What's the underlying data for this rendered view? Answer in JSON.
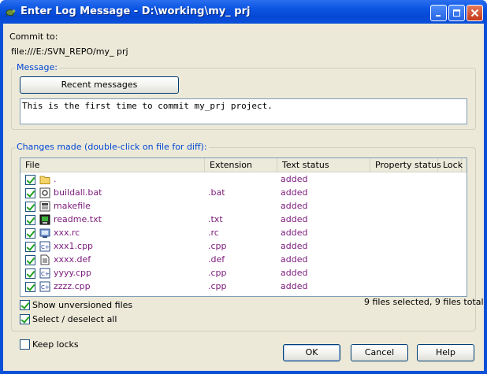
{
  "window": {
    "title": "Enter Log Message - D:\\working\\my_ prj"
  },
  "commit": {
    "label": "Commit to:",
    "url": "file:///E:/SVN_REPO/my_ prj"
  },
  "message_group": {
    "title": "Message:",
    "recent_button": "Recent messages",
    "text": "This is the first time to commit my_prj project."
  },
  "changes_group": {
    "title": "Changes made (double-click on file for diff):",
    "columns": [
      "File",
      "Extension",
      "Text status",
      "Property status",
      "Lock"
    ],
    "rows": [
      {
        "name": ".",
        "ext": "",
        "status": "added",
        "checked": true,
        "icon": "folder-icon"
      },
      {
        "name": "buildall.bat",
        "ext": ".bat",
        "status": "added",
        "checked": true,
        "icon": "batch-file-icon"
      },
      {
        "name": "makefile",
        "ext": "",
        "status": "added",
        "checked": true,
        "icon": "makefile-icon"
      },
      {
        "name": "readme.txt",
        "ext": ".txt",
        "status": "added",
        "checked": true,
        "icon": "text-file-icon"
      },
      {
        "name": "xxx.rc",
        "ext": ".rc",
        "status": "added",
        "checked": true,
        "icon": "resource-file-icon"
      },
      {
        "name": "xxx1.cpp",
        "ext": ".cpp",
        "status": "added",
        "checked": true,
        "icon": "cpp-file-icon"
      },
      {
        "name": "xxxx.def",
        "ext": ".def",
        "status": "added",
        "checked": true,
        "icon": "def-file-icon"
      },
      {
        "name": "yyyy.cpp",
        "ext": ".cpp",
        "status": "added",
        "checked": true,
        "icon": "cpp-file-icon"
      },
      {
        "name": "zzzz.cpp",
        "ext": ".cpp",
        "status": "added",
        "checked": true,
        "icon": "cpp-file-icon"
      }
    ],
    "show_unversioned": {
      "label": "Show unversioned files",
      "checked": true
    },
    "select_all": {
      "label": "Select / deselect all",
      "checked": true
    },
    "summary": "9 files selected, 9 files total"
  },
  "keep_locks": {
    "label": "Keep locks",
    "checked": false
  },
  "buttons": {
    "ok": "OK",
    "cancel": "Cancel",
    "help": "Help"
  }
}
